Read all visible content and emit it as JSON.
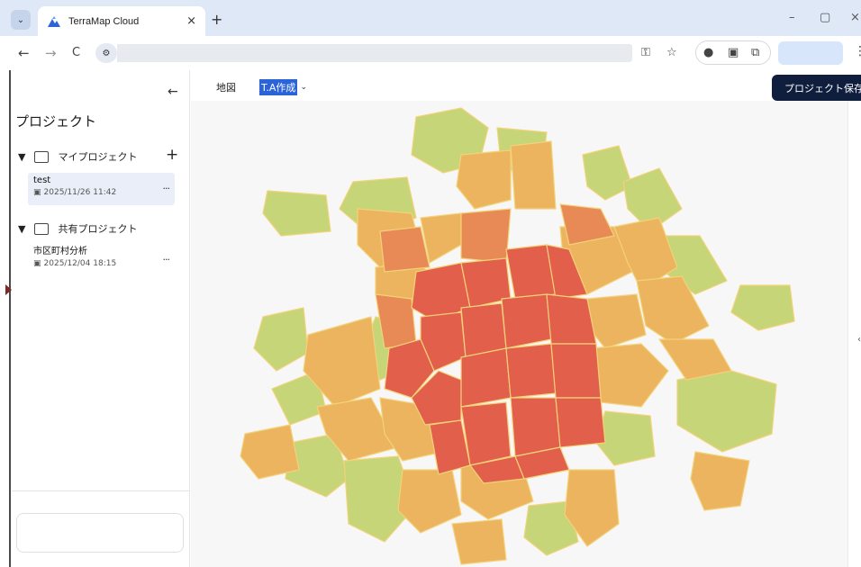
{
  "browser": {
    "tab_title": "TerraMap Cloud",
    "tab_close": "×",
    "new_tab": "+",
    "win_min": "–",
    "win_max": "▢",
    "win_close": "×",
    "back": "←",
    "forward": "→",
    "reload": "C",
    "menu": "⋮"
  },
  "sidebar": {
    "collapse_label": "←",
    "title": "プロジェクト",
    "my_projects": {
      "label": "マイプロジェクト",
      "add_label": "+",
      "items": [
        {
          "name": "test",
          "date": "2025/11/26 11:42",
          "more": "..."
        }
      ]
    },
    "shared_projects": {
      "label": "共有プロジェクト",
      "items": [
        {
          "name": "市区町村分析",
          "date": "2025/12/04 18:15",
          "more": "..."
        }
      ]
    }
  },
  "toolbar": {
    "tab_map": "地図",
    "tab_ta": "T.A作成",
    "save_label": "プロジェクト保存"
  },
  "map": {
    "legend_colors": {
      "high": "#e2604b",
      "mid_high": "#e88a55",
      "mid": "#ecb45e",
      "low": "#c5d578"
    }
  }
}
